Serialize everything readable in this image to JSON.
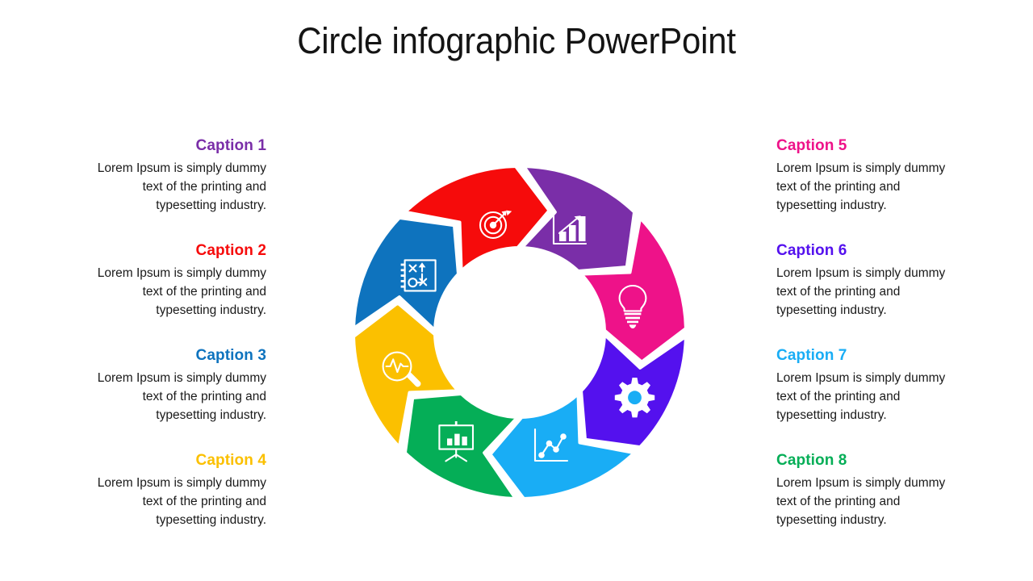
{
  "title": "Circle infographic PowerPoint",
  "body_text": "Lorem Ipsum is simply dummy text of the printing and typesetting industry.",
  "colors": {
    "purple": "#7A2EA8",
    "red": "#F60B0B",
    "steel_blue": "#0E73BE",
    "amber": "#FBC000",
    "pink": "#EE1289",
    "violet": "#5411EE",
    "cyan": "#19ADF5",
    "green": "#05AE57",
    "title_text": "#141414",
    "body_text": "#1a1a1a",
    "background": "#ffffff"
  },
  "left_column": [
    {
      "label": "Caption 1",
      "color": "#7A2EA8",
      "body": "Lorem Ipsum is simply dummy text of the printing and typesetting industry.",
      "icon": "target-arrow-icon"
    },
    {
      "label": "Caption 2",
      "color": "#F60B0B",
      "body": "Lorem Ipsum is simply dummy text of the printing and typesetting industry.",
      "icon": "strategy-playbook-icon"
    },
    {
      "label": "Caption 3",
      "color": "#0E73BE",
      "body": "Lorem Ipsum is simply dummy text of the printing and typesetting industry.",
      "icon": "magnifier-pulse-icon"
    },
    {
      "label": "Caption 4",
      "color": "#FBC000",
      "body": "Lorem Ipsum is simply dummy text of the printing and typesetting industry.",
      "icon": "presentation-chart-icon"
    }
  ],
  "right_column": [
    {
      "label": "Caption 5",
      "color": "#EE1289",
      "body": "Lorem Ipsum is simply dummy text of the printing and typesetting industry.",
      "icon": "bar-chart-growth-icon"
    },
    {
      "label": "Caption 6",
      "color": "#5411EE",
      "body": "Lorem Ipsum is simply dummy text of the printing and typesetting industry.",
      "icon": "lightbulb-icon"
    },
    {
      "label": "Caption 7",
      "color": "#19ADF5",
      "body": "Lorem Ipsum is simply dummy text of the printing and typesetting industry.",
      "icon": "gear-icon"
    },
    {
      "label": "Caption 8",
      "color": "#05AE57",
      "body": "Lorem Ipsum is simply dummy text of the printing and typesetting industry.",
      "icon": "line-graph-icon"
    }
  ],
  "chart_data": {
    "type": "pie",
    "title": "Circle infographic PowerPoint",
    "subtype": "donut-arrow-cycle",
    "segment_count": 8,
    "equal_segments": true,
    "segment_share_percent": 12.5,
    "inner_radius_px": 105,
    "outer_radius_px": 208,
    "legend": "left and right caption columns",
    "categories": [
      "Caption 1",
      "Caption 2",
      "Caption 3",
      "Caption 4",
      "Caption 5",
      "Caption 6",
      "Caption 7",
      "Caption 8"
    ],
    "values": [
      12.5,
      12.5,
      12.5,
      12.5,
      12.5,
      12.5,
      12.5,
      12.5
    ],
    "colors": [
      "#7A2EA8",
      "#F60B0B",
      "#0E73BE",
      "#FBC000",
      "#EE1289",
      "#5411EE",
      "#19ADF5",
      "#05AE57"
    ],
    "segments": [
      {
        "index": 1,
        "label": "Caption 1",
        "color": "#7A2EA8",
        "icon": "target-arrow-icon",
        "position": "top-left",
        "start_angle_deg": -90,
        "end_angle_deg": -45
      },
      {
        "index": 5,
        "label": "Caption 5",
        "color": "#EE1289",
        "icon": "bar-chart-growth-icon",
        "position": "top-right",
        "start_angle_deg": -45,
        "end_angle_deg": 0
      },
      {
        "index": 6,
        "label": "Caption 6",
        "color": "#5411EE",
        "icon": "lightbulb-icon",
        "position": "right-upper",
        "start_angle_deg": 0,
        "end_angle_deg": 45
      },
      {
        "index": 7,
        "label": "Caption 7",
        "color": "#19ADF5",
        "icon": "gear-icon",
        "position": "right-lower",
        "start_angle_deg": 45,
        "end_angle_deg": 90
      },
      {
        "index": 8,
        "label": "Caption 8",
        "color": "#05AE57",
        "icon": "line-graph-icon",
        "position": "bottom-right",
        "start_angle_deg": 90,
        "end_angle_deg": 135
      },
      {
        "index": 4,
        "label": "Caption 4",
        "color": "#FBC000",
        "icon": "presentation-chart-icon",
        "position": "bottom-left",
        "start_angle_deg": 135,
        "end_angle_deg": 180
      },
      {
        "index": 3,
        "label": "Caption 3",
        "color": "#0E73BE",
        "icon": "magnifier-pulse-icon",
        "position": "left-lower",
        "start_angle_deg": 180,
        "end_angle_deg": 225
      },
      {
        "index": 2,
        "label": "Caption 2",
        "color": "#F60B0B",
        "icon": "strategy-playbook-icon",
        "position": "left-upper",
        "start_angle_deg": 225,
        "end_angle_deg": 270
      }
    ]
  }
}
